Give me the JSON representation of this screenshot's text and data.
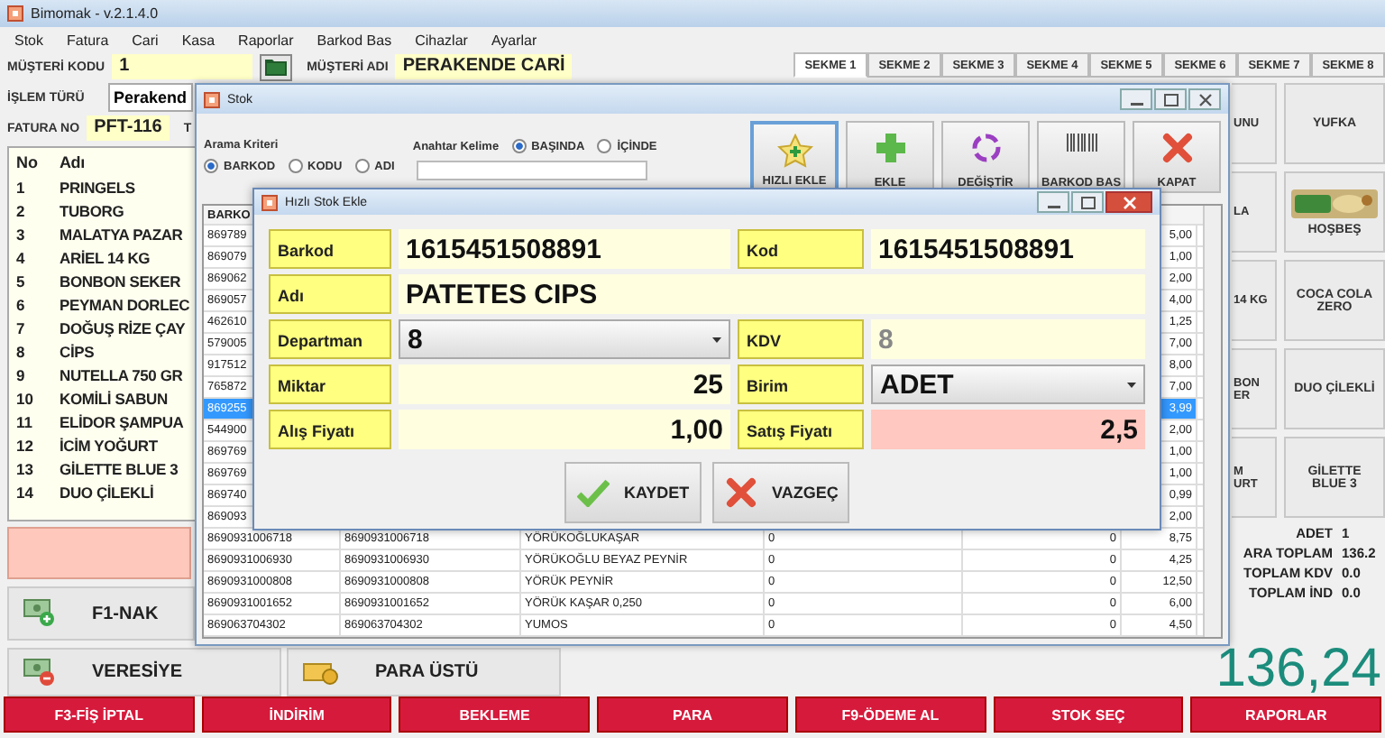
{
  "window": {
    "title": "Bimomak - v.2.1.4.0"
  },
  "menu": [
    "Stok",
    "Fatura",
    "Cari",
    "Kasa",
    "Raporlar",
    "Barkod Bas",
    "Cihazlar",
    "Ayarlar"
  ],
  "customer": {
    "code_label": "MÜŞTERİ KODU",
    "code": "1",
    "name_label": "MÜŞTERİ ADI",
    "name": "PERAKENDE CARİ",
    "type_label": "İŞLEM TÜRÜ",
    "type": "Perakend",
    "invoice_label": "FATURA NO",
    "invoice": "PFT-116",
    "label_cut": "T"
  },
  "items": {
    "columns": [
      "No",
      "Adı"
    ],
    "rows": [
      [
        "1",
        "PRINGELS"
      ],
      [
        "2",
        "TUBORG"
      ],
      [
        "3",
        "MALATYA PAZAR"
      ],
      [
        "4",
        "ARİEL 14 KG"
      ],
      [
        "5",
        "BONBON SEKER"
      ],
      [
        "6",
        "PEYMAN DORLEC"
      ],
      [
        "7",
        "DOĞUŞ RİZE ÇAY"
      ],
      [
        "8",
        "CİPS"
      ],
      [
        "9",
        "NUTELLA 750 GR"
      ],
      [
        "10",
        "KOMİLİ SABUN"
      ],
      [
        "11",
        "ELİDOR ŞAMPUA"
      ],
      [
        "12",
        "İCİM YOĞURT"
      ],
      [
        "13",
        "GİLETTE BLUE 3"
      ],
      [
        "14",
        "DUO ÇİLEKLİ"
      ]
    ]
  },
  "payment": [
    {
      "label": "F1-NAK",
      "kind": "cash"
    },
    {
      "label": "VERESİYE",
      "kind": "credit"
    },
    {
      "label": "PARA ÜSTÜ",
      "kind": "change"
    }
  ],
  "tabs": [
    {
      "label": "SEKME 1",
      "selected": true
    },
    {
      "label": "SEKME 2",
      "selected": false
    },
    {
      "label": "SEKME 3",
      "selected": false
    },
    {
      "label": "SEKME 4",
      "selected": false
    },
    {
      "label": "SEKME 5",
      "selected": false
    },
    {
      "label": "SEKME 6",
      "selected": false
    },
    {
      "label": "SEKME 7",
      "selected": false
    },
    {
      "label": "SEKME 8",
      "selected": false
    }
  ],
  "tiles": [
    {
      "label": "UNU",
      "kind": "text"
    },
    {
      "label": "YUFKA",
      "kind": "text"
    },
    {
      "label": "LA",
      "kind": "text"
    },
    {
      "label": "HOŞBEŞ",
      "kind": "picture"
    },
    {
      "label": "14 KG",
      "kind": "text"
    },
    {
      "label": "COCA COLA ZERO",
      "kind": "text"
    },
    {
      "label": "BON\nER",
      "kind": "text"
    },
    {
      "label": "DUO ÇİLEKLİ",
      "kind": "text"
    },
    {
      "label": "M\nURT",
      "kind": "text"
    },
    {
      "label": "GİLETTE BLUE 3",
      "kind": "text"
    }
  ],
  "totals": [
    {
      "label": "ADET",
      "value": "1"
    },
    {
      "label": "ARA TOPLAM",
      "value": "136.2"
    },
    {
      "label": "TOPLAM KDV",
      "value": "0.0"
    },
    {
      "label": "TOPLAM İND",
      "value": "0.0"
    }
  ],
  "grand_total": "136,24",
  "actions": [
    "F3-FİŞ İPTAL",
    "İNDİRİM",
    "BEKLEME",
    "PARA",
    "F9-ÖDEME AL",
    "STOK SEÇ",
    "RAPORLAR"
  ],
  "stock_window": {
    "title": "Stok",
    "search_label": "Arama Kriteri",
    "criteria": [
      {
        "label": "BARKOD",
        "selected": true
      },
      {
        "label": "KODU",
        "selected": false
      },
      {
        "label": "ADI",
        "selected": false
      }
    ],
    "keyword_label": "Anahtar Kelime",
    "match": [
      {
        "label": "BAŞINDA",
        "selected": true
      },
      {
        "label": "İÇİNDE",
        "selected": false
      }
    ],
    "tools": [
      {
        "label": "HIZLI EKLE",
        "kind": "star",
        "focused": true
      },
      {
        "label": "EKLE",
        "kind": "plus",
        "focused": false
      },
      {
        "label": "DEĞİŞTİR",
        "kind": "cycle",
        "focused": false
      },
      {
        "label": "BARKOD BAS",
        "kind": "barcode",
        "focused": false
      },
      {
        "label": "KAPAT",
        "kind": "close",
        "focused": false
      }
    ],
    "table": {
      "columns": [
        "BARKO"
      ],
      "rows": [
        {
          "column_1": "869789",
          "column_6": "5,00",
          "selected": false
        },
        {
          "column_1": "869079",
          "column_6": "1,00",
          "selected": false
        },
        {
          "column_1": "869062",
          "column_6": "2,00",
          "selected": false
        },
        {
          "column_1": "869057",
          "column_6": "4,00",
          "selected": false
        },
        {
          "column_1": "462610",
          "column_6": "1,25",
          "selected": false
        },
        {
          "column_1": "579005",
          "column_6": "7,00",
          "selected": false
        },
        {
          "column_1": "917512",
          "column_6": "8,00",
          "selected": false
        },
        {
          "column_1": "765872",
          "column_6": "7,00",
          "selected": false
        },
        {
          "column_1": "869255",
          "column_6": "3,99",
          "selected": true
        },
        {
          "column_1": "544900",
          "column_6": "2,00",
          "selected": false
        },
        {
          "column_1": "869769",
          "column_6": "1,00",
          "selected": false
        },
        {
          "column_1": "869769",
          "column_6": "1,00",
          "selected": false
        },
        {
          "column_1": "869740",
          "column_6": "0,99",
          "selected": false
        },
        {
          "column_1": "869093",
          "column_6": "2,00",
          "selected": false
        },
        {
          "column_1": "8690931006718",
          "column_2": "8690931006718",
          "column_3": "YÖRÜKOĞLUKAŞAR",
          "column_4": "0",
          "column_5": "0",
          "column_6": "8,75",
          "selected": false
        },
        {
          "column_1": "8690931006930",
          "column_2": "8690931006930",
          "column_3": "YÖRÜKOĞLU BEYAZ PEYNİR",
          "column_4": "0",
          "column_5": "0",
          "column_6": "4,25",
          "selected": false
        },
        {
          "column_1": "8690931000808",
          "column_2": "8690931000808",
          "column_3": "YÖRÜK PEYNİR",
          "column_4": "0",
          "column_5": "0",
          "column_6": "12,50",
          "selected": false
        },
        {
          "column_1": "8690931001652",
          "column_2": "8690931001652",
          "column_3": "YÖRÜK KAŞAR 0,250",
          "column_4": "0",
          "column_5": "0",
          "column_6": "6,00",
          "selected": false
        },
        {
          "column_1": "869063704302",
          "column_2": "869063704302",
          "column_3": "YUMOS",
          "column_4": "0",
          "column_5": "0",
          "column_6": "4,50",
          "selected": false
        }
      ]
    }
  },
  "quick_add": {
    "title": "Hızlı Stok Ekle",
    "fields": [
      {
        "label": "Barkod",
        "value": "1615451508891",
        "kind": "text",
        "wide": false,
        "readonly": false,
        "highlighted": false
      },
      {
        "label": "Kod",
        "value": "1615451508891",
        "kind": "text",
        "wide": false,
        "readonly": false,
        "highlighted": false
      },
      {
        "label": "Adı",
        "value": "PATETES CIPS",
        "kind": "text",
        "wide": true,
        "readonly": false,
        "highlighted": false
      },
      {
        "label": "Departman",
        "value": "8",
        "kind": "combo",
        "wide": false,
        "readonly": false,
        "highlighted": false
      },
      {
        "label": "KDV",
        "value": "8",
        "kind": "text",
        "wide": false,
        "readonly": true,
        "highlighted": false
      },
      {
        "label": "Miktar",
        "value": "25",
        "kind": "number",
        "wide": false,
        "readonly": false,
        "highlighted": false
      },
      {
        "label": "Birim",
        "value": "ADET",
        "kind": "combo",
        "wide": false,
        "readonly": false,
        "highlighted": false
      },
      {
        "label": "Alış Fiyatı",
        "value": "1,00",
        "kind": "number",
        "wide": false,
        "readonly": false,
        "highlighted": false
      },
      {
        "label": "Satış Fiyatı",
        "value": "2,5",
        "kind": "number",
        "wide": false,
        "readonly": false,
        "highlighted": true
      }
    ],
    "buttons": [
      {
        "label": "KAYDET",
        "kind": "save"
      },
      {
        "label": "VAZGEÇ",
        "kind": "cancel"
      }
    ]
  }
}
